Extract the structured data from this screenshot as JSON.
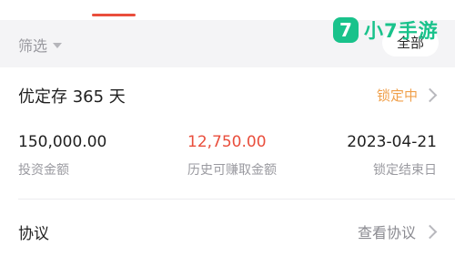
{
  "watermark": {
    "badge": "7",
    "text": "小7手游"
  },
  "filter": {
    "label": "筛选",
    "all_button": "全部"
  },
  "product": {
    "title": "优定存 365 天",
    "status": "锁定中",
    "metrics": [
      {
        "value": "150,000.00",
        "label": "投资金额"
      },
      {
        "value": "12,750.00",
        "label": "历史可赚取金额"
      },
      {
        "value": "2023-04-21",
        "label": "锁定结束日"
      }
    ]
  },
  "agreement": {
    "label": "协议",
    "link": "查看协议"
  },
  "colors": {
    "accent_red": "#e94e3c",
    "status_orange": "#f0a04b",
    "watermark_green": "#19c28b"
  }
}
